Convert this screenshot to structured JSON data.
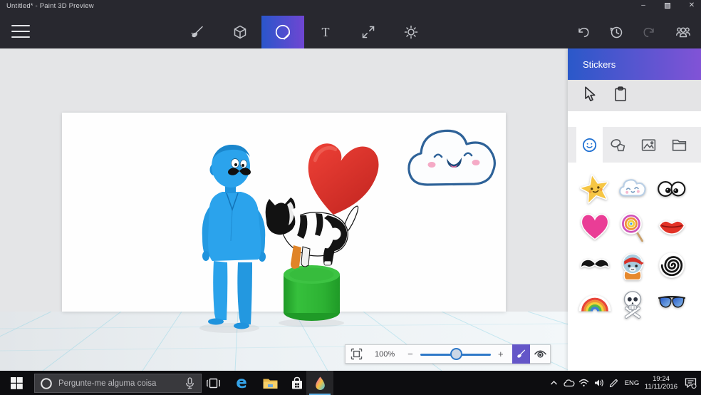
{
  "window": {
    "title": "Untitled* - Paint 3D Preview",
    "controls": {
      "minimize_glyph": "–",
      "close_glyph": "✕"
    }
  },
  "toolbar": {
    "tools": [
      "brush",
      "3d-objects",
      "stickers",
      "text",
      "canvas",
      "effects"
    ],
    "selected_tool": "stickers",
    "text_tool_glyph": "T",
    "history_tools": [
      "undo",
      "history",
      "redo"
    ],
    "remix_tool": "remix-3d-community"
  },
  "panel": {
    "title": "Stickers",
    "tools": [
      "select",
      "paste"
    ],
    "tabs": [
      "sticker-faces",
      "shapes",
      "pictures",
      "custom"
    ],
    "selected_tab": "sticker-faces",
    "stickers": [
      "star",
      "cloud",
      "googly-eyes",
      "heart",
      "lollipop",
      "lips",
      "mustache",
      "pirate-cat",
      "spiral",
      "rainbow",
      "skull",
      "sunglasses"
    ]
  },
  "scene": {
    "objects": [
      "blue-man",
      "red-heart",
      "dog",
      "green-cylinder",
      "cloud-sticker"
    ]
  },
  "zoom_bar": {
    "zoom_level": "100%",
    "minus": "−",
    "plus": "+"
  },
  "taskbar": {
    "search_placeholder": "Pergunte-me alguma coisa",
    "apps": [
      "task-view",
      "edge",
      "file-explorer",
      "store",
      "paint-3d"
    ],
    "active_app": "paint-3d",
    "tray": {
      "language": "ENG",
      "time": "19:24",
      "date": "11/11/2016"
    }
  },
  "colors": {
    "accent_gradient_start": "#2a56cb",
    "accent_gradient_end": "#7a4fd3",
    "topbar": "#28282f",
    "active_underline": "#5fb2e8"
  }
}
